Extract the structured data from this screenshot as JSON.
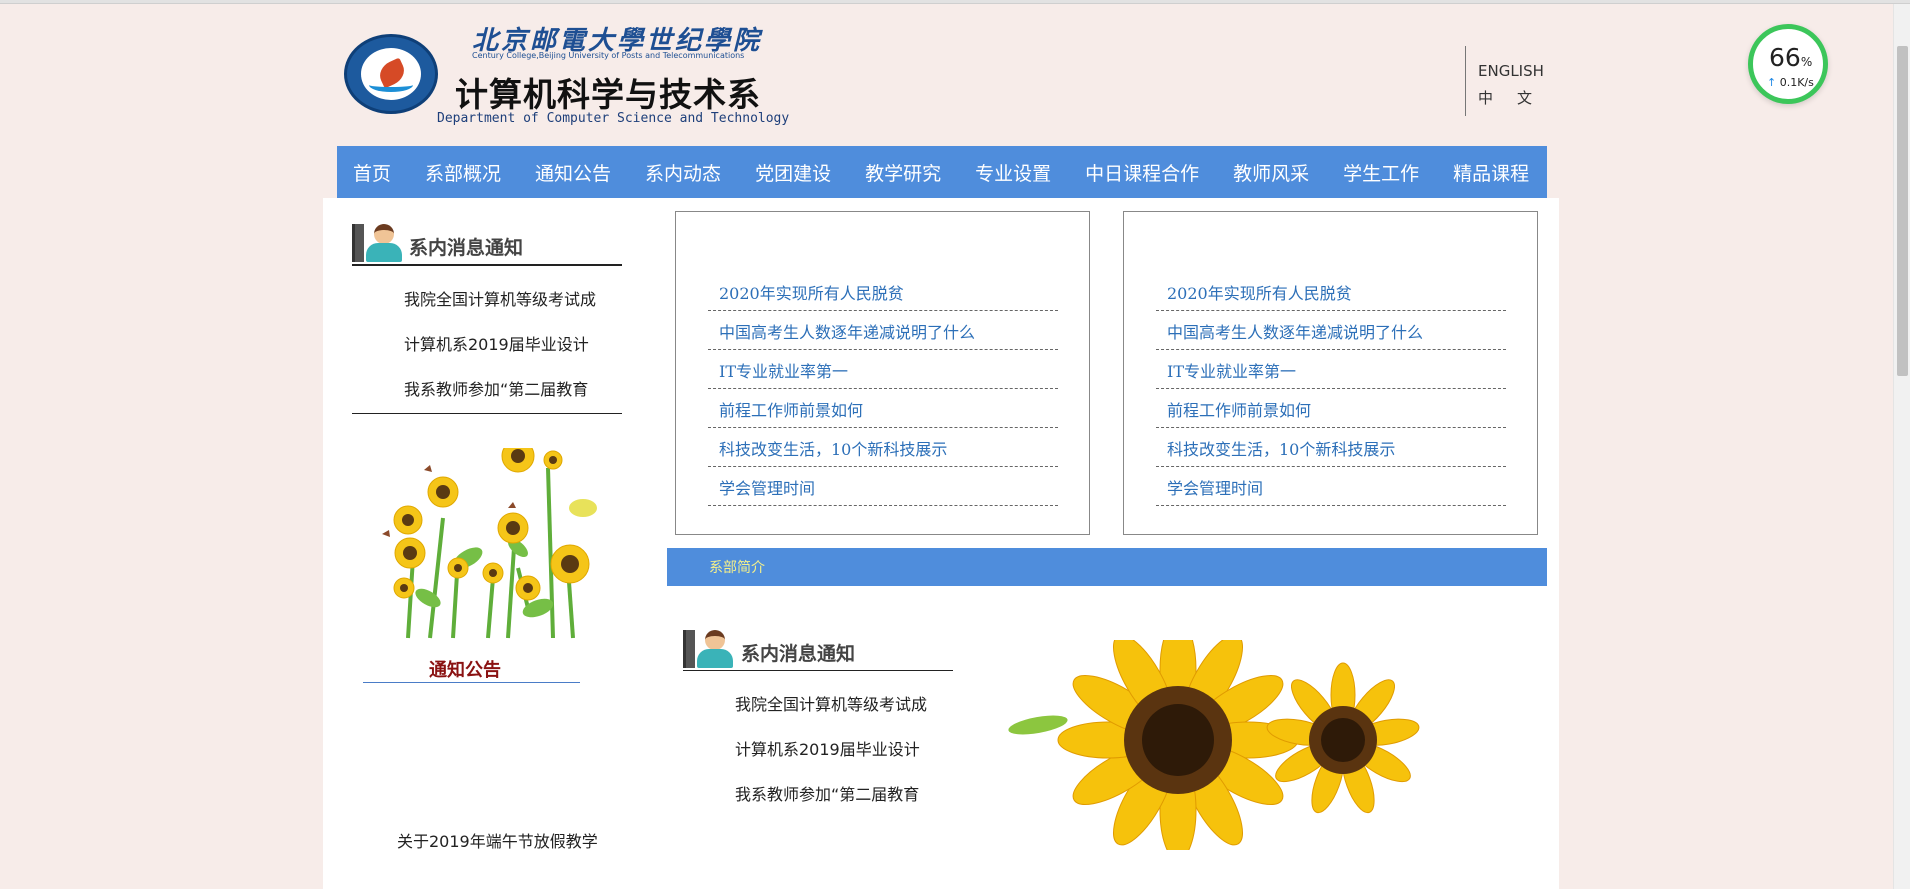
{
  "header": {
    "school_cn": "北京邮電大學世纪學院",
    "school_en": "Century College,Beijing University of Posts and Telecommunications",
    "dept_cn": "计算机科学与技术系",
    "dept_en": "Department of Computer Science and Technology",
    "lang_en": "ENGLISH",
    "lang_cn": "中文"
  },
  "speed_widget": {
    "percent": "66",
    "unit": "%",
    "rate": "0.1K/s"
  },
  "nav": {
    "items": [
      "首页",
      "系部概况",
      "通知公告",
      "系内动态",
      "党团建设",
      "教学研究",
      "专业设置",
      "中日课程合作",
      "教师风采",
      "学生工作",
      "精品课程"
    ]
  },
  "left_section": {
    "title": "系内消息通知",
    "items": [
      "我院全国计算机等级考试成",
      "计算机系2019届毕业设计",
      "我系教师参加“第二届教育"
    ]
  },
  "notice": {
    "title": "通知公告",
    "items": [
      "关于2019年端午节放假教学"
    ]
  },
  "news_box_1": {
    "items": [
      "2020年实现所有人民脱贫",
      "中国高考生人数逐年递减说明了什么",
      "IT专业就业率第一",
      "前程工作师前景如何",
      "科技改变生活，10个新科技展示",
      "学会管理时间"
    ]
  },
  "news_box_2": {
    "items": [
      "2020年实现所有人民脱贫",
      "中国高考生人数逐年递减说明了什么",
      "IT专业就业率第一",
      "前程工作师前景如何",
      "科技改变生活，10个新科技展示",
      "学会管理时间"
    ]
  },
  "intro_bar": {
    "label": "系部简介"
  },
  "center_section": {
    "title": "系内消息通知",
    "items": [
      "我院全国计算机等级考试成",
      "计算机系2019届毕业设计",
      "我系教师参加“第二届教育"
    ]
  },
  "colors": {
    "nav_blue": "#4f8ddc",
    "link_blue": "#2c6fb8",
    "page_bg": "#f7ece9",
    "notice_red": "#8a1212",
    "gauge_green": "#3cc65a"
  }
}
